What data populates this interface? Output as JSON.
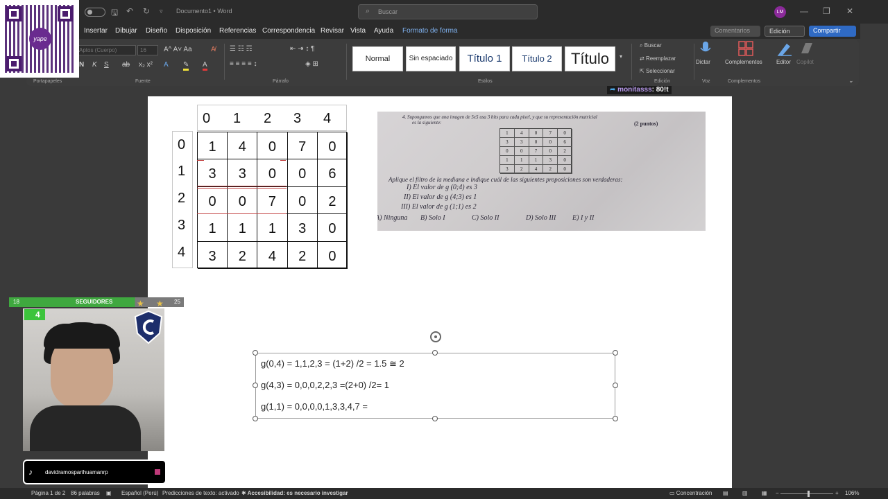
{
  "titlebar": {
    "document_title": "Documento1",
    "app_name": "Word",
    "title_separator": "•",
    "search_placeholder": "Buscar",
    "user_initials": "LM"
  },
  "ribbon_tabs": [
    "Insertar",
    "Dibujar",
    "Diseño",
    "Disposición",
    "Referencias",
    "Correspondencia",
    "Revisar",
    "Vista",
    "Ayuda",
    "Formato de forma"
  ],
  "ribbon_buttons": {
    "comments": "Comentarios",
    "editing": "Edición",
    "share": "Compartir"
  },
  "ribbon": {
    "font_name": "Aptos (Cuerpo)",
    "font_size": "16",
    "styles": [
      "Normal",
      "Sin espaciado",
      "Título 1",
      "Título 2",
      "Título"
    ],
    "find": "Buscar",
    "replace": "Reemplazar",
    "select": "Seleccionar",
    "dictate": "Dictar",
    "addins": "Complementos",
    "editor": "Editor",
    "copilot": "Copilot",
    "groups": {
      "clipboard": "Portapapeles",
      "font": "Fuente",
      "paragraph": "Párrafo",
      "styles": "Estilos",
      "editing": "Edición",
      "voice": "Voz",
      "addins": "Complementos"
    }
  },
  "matrix": {
    "col_headers": [
      "0",
      "1",
      "2",
      "3",
      "4"
    ],
    "row_headers": [
      "0",
      "1",
      "2",
      "3",
      "4"
    ],
    "rows": [
      [
        "1",
        "4",
        "0",
        "7",
        "0"
      ],
      [
        "3",
        "3",
        "0",
        "0",
        "6"
      ],
      [
        "0",
        "0",
        "7",
        "0",
        "2"
      ],
      [
        "1",
        "1",
        "1",
        "3",
        "0"
      ],
      [
        "3",
        "2",
        "4",
        "2",
        "0"
      ]
    ]
  },
  "photo": {
    "question_line1": "4.    Supongamos que una imagen de 5x5 usa 3 bits para cada pixel, y que su representación matricial",
    "question_line2": "es la siguiente:",
    "points": "(2 puntos)",
    "grid": [
      [
        "1",
        "4",
        "0",
        "7",
        "0"
      ],
      [
        "3",
        "3",
        "0",
        "0",
        "6"
      ],
      [
        "0",
        "0",
        "7",
        "0",
        "2"
      ],
      [
        "1",
        "1",
        "1",
        "3",
        "0"
      ],
      [
        "3",
        "2",
        "4",
        "2",
        "0"
      ]
    ],
    "instruction": "Aplique el filtro de la mediana e indique cuál de las siguientes proposiciones son verdaderas:",
    "props": [
      "I)    El valor de g (0;4) es 3",
      "II)   El valor de g (4;3) es 1",
      "III) El valor de g (1;1) es 2"
    ],
    "options": [
      "A) Ninguna",
      "B) Solo I",
      "C) Solo II",
      "D) Solo III",
      "E) I y II"
    ]
  },
  "textbox": {
    "lines": [
      "g(0,4) = 1,1,2,3 = (1+2) /2 = 1.5 ≅ 2",
      "g(4,3) = 0,0,0,2,2,3 =(2+0) /2= 1",
      "g(1,1) = 0,0,0,0,1,3,3,4,7 ="
    ]
  },
  "statusbar": {
    "page": "Página 1 de 2",
    "words": "86 palabras",
    "language": "Español (Perú)",
    "predictions": "Predicciones de texto: activado",
    "accessibility": "Accesibilidad: es necesario investigar",
    "focus": "Concentración",
    "zoom": "106%"
  },
  "overlay": {
    "qr_brand": "yape",
    "followers_label": "SEGUIDORES",
    "followers_left": "18",
    "followers_right": "25",
    "cam_badge": "4",
    "tiktok_user": "davidramosparihuamanrp",
    "chat_user": "monitasss",
    "chat_msg": ": 80!t"
  },
  "colors": {
    "accent_share": "#2f6ac4",
    "followers_bar": "#3fa83f",
    "avatar": "#8b2a9a"
  }
}
